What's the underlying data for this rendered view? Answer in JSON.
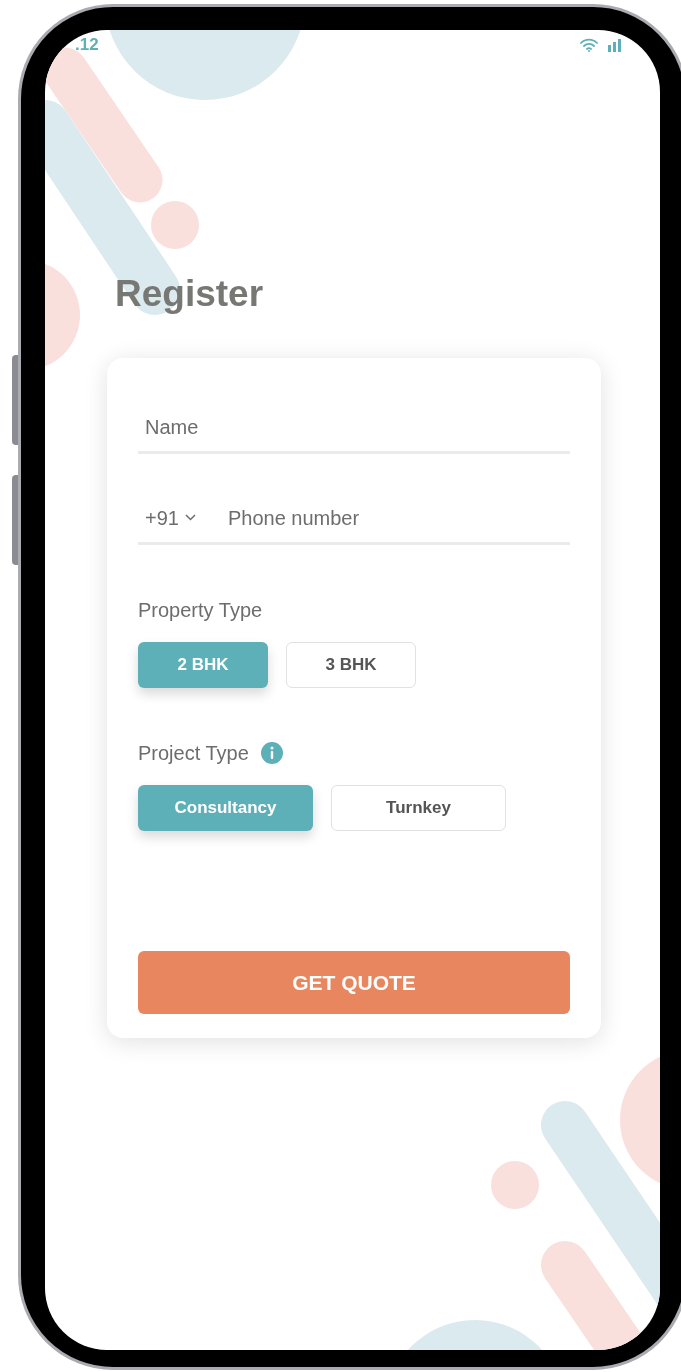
{
  "status_bar": {
    "time": ".12"
  },
  "title": "Register",
  "form": {
    "name_field": {
      "placeholder": "Name"
    },
    "phone_field": {
      "country_code": "+91",
      "placeholder": "Phone number"
    },
    "property_type": {
      "label": "Property Type",
      "options": [
        {
          "label": "2 BHK",
          "selected": true
        },
        {
          "label": "3 BHK",
          "selected": false
        }
      ]
    },
    "project_type": {
      "label": "Project Type",
      "options": [
        {
          "label": "Consultancy",
          "selected": true
        },
        {
          "label": "Turnkey",
          "selected": false
        }
      ]
    },
    "submit": "GET QUOTE"
  }
}
